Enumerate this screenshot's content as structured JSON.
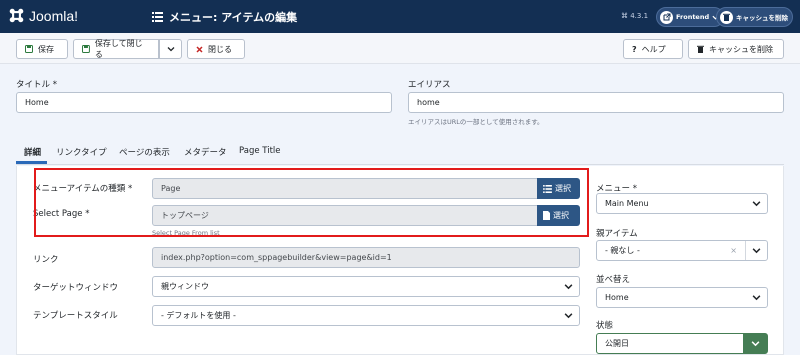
{
  "header": {
    "logo_text": "Joomla!",
    "title": "メニュー: アイテムの編集",
    "version": "⌘ 4.3.1",
    "frontend_label": "Frontend",
    "clear_cache_label": "キャッシュを削除"
  },
  "toolbar": {
    "save_label": "保存",
    "save_close_label": "保存して閉じる",
    "close_label": "閉じる",
    "help_label": "ヘルプ",
    "clear_cache_label": "キャッシュを削除"
  },
  "form": {
    "title_label": "タイトル *",
    "title_value": "Home",
    "alias_label": "エイリアス",
    "alias_value": "home",
    "alias_hint": "エイリアスはURLの一部として使用されます。"
  },
  "tabs": [
    "詳細",
    "リンクタイプ",
    "ページの表示",
    "メタデータ",
    "Page Title"
  ],
  "details": {
    "item_type_label": "メニューアイテムの種類 *",
    "item_type_value": "Page",
    "select_label": "選択",
    "select_page_label": "Select Page *",
    "select_page_value": "トップページ",
    "select_page_hint": "Select Page From list",
    "link_label": "リンク",
    "link_value": "index.php?option=com_sppagebuilder&view=page&id=1",
    "target_label": "ターゲットウィンドウ",
    "target_value": "親ウィンドウ",
    "template_label": "テンプレートスタイル",
    "template_value": "- デフォルトを使用 -"
  },
  "sidebar": {
    "menu_label": "メニュー *",
    "menu_value": "Main Menu",
    "parent_label": "親アイテム",
    "parent_value": "- 親なし -",
    "order_label": "並べ替え",
    "order_value": "Home",
    "status_label": "状態",
    "status_value": "公開日"
  },
  "colors": {
    "header_bg": "#132f53",
    "accent": "#2d5685",
    "highlight": "#e21b1b",
    "status_green": "#457d54"
  }
}
